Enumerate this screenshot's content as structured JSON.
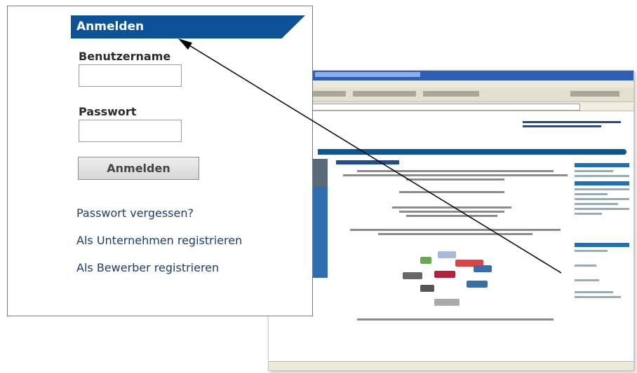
{
  "login": {
    "title": "Anmelden",
    "username_label": "Benutzername",
    "username_value": "",
    "password_label": "Passwort",
    "password_value": "",
    "submit_label": "Anmelden",
    "forgot_password": "Passwort vergessen?",
    "register_company": "Als Unternehmen registrieren",
    "register_applicant": "Als Bewerber registrieren"
  },
  "colors": {
    "header_bg": "#0c5296",
    "link": "#1a3f6e"
  }
}
